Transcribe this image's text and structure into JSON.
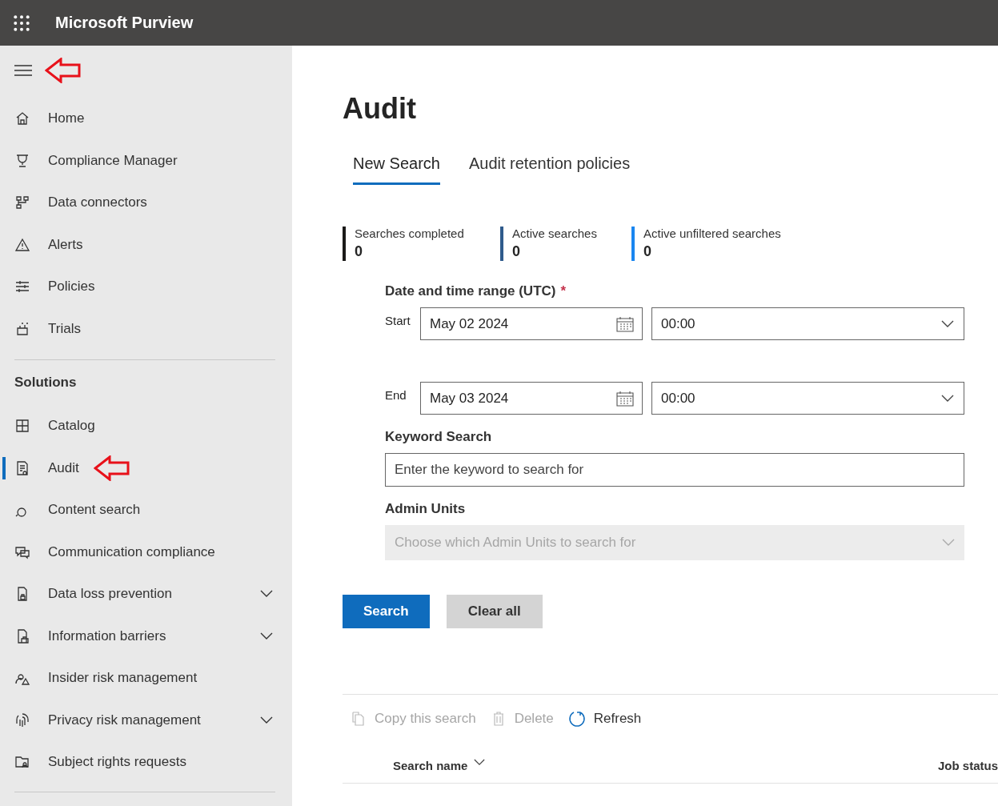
{
  "header": {
    "title": "Microsoft Purview"
  },
  "sidebar": {
    "items": [
      {
        "label": "Home",
        "selected": false,
        "has_submenu": false
      },
      {
        "label": "Compliance Manager",
        "selected": false,
        "has_submenu": false
      },
      {
        "label": "Data connectors",
        "selected": false,
        "has_submenu": false
      },
      {
        "label": "Alerts",
        "selected": false,
        "has_submenu": false
      },
      {
        "label": "Policies",
        "selected": false,
        "has_submenu": false
      },
      {
        "label": "Trials",
        "selected": false,
        "has_submenu": false
      }
    ],
    "section_title": "Solutions",
    "solutions": [
      {
        "label": "Catalog",
        "selected": false,
        "has_submenu": false
      },
      {
        "label": "Audit",
        "selected": true,
        "has_submenu": false
      },
      {
        "label": "Content search",
        "selected": false,
        "has_submenu": false
      },
      {
        "label": "Communication compliance",
        "selected": false,
        "has_submenu": false
      },
      {
        "label": "Data loss prevention",
        "selected": false,
        "has_submenu": true
      },
      {
        "label": "Information barriers",
        "selected": false,
        "has_submenu": true
      },
      {
        "label": "Insider risk management",
        "selected": false,
        "has_submenu": false
      },
      {
        "label": "Privacy risk management",
        "selected": false,
        "has_submenu": true
      },
      {
        "label": "Subject rights requests",
        "selected": false,
        "has_submenu": false
      }
    ]
  },
  "page": {
    "title": "Audit",
    "tabs": [
      {
        "label": "New Search",
        "selected": true
      },
      {
        "label": "Audit retention policies",
        "selected": false
      }
    ],
    "stats": [
      {
        "label": "Searches completed",
        "value": "0",
        "color": "#1b1a19"
      },
      {
        "label": "Active searches",
        "value": "0",
        "color": "#2f5b8c"
      },
      {
        "label": "Active unfiltered searches",
        "value": "0",
        "color": "#1a86f0"
      }
    ],
    "date_range": {
      "label": "Date and time range (UTC)",
      "required_mark": "*",
      "rows": [
        {
          "label": "Start",
          "date": "May 02 2024",
          "time": "00:00"
        },
        {
          "label": "End",
          "date": "May 03 2024",
          "time": "00:00"
        }
      ]
    },
    "keyword": {
      "label": "Keyword Search",
      "placeholder": "Enter the keyword to search for"
    },
    "admin_units": {
      "label": "Admin Units",
      "placeholder": "Choose which Admin Units to search for",
      "disabled": true
    },
    "buttons": [
      {
        "label": "Search",
        "kind": "primary"
      },
      {
        "label": "Clear all",
        "kind": "secondary"
      }
    ],
    "toolbar": [
      {
        "label": "Copy this search",
        "disabled": true
      },
      {
        "label": "Delete",
        "disabled": true
      },
      {
        "label": "Refresh",
        "disabled": false
      }
    ],
    "table": {
      "columns": [
        {
          "label": "Search name",
          "sortable": true
        },
        {
          "label": "Job status",
          "sortable": false
        }
      ]
    }
  }
}
